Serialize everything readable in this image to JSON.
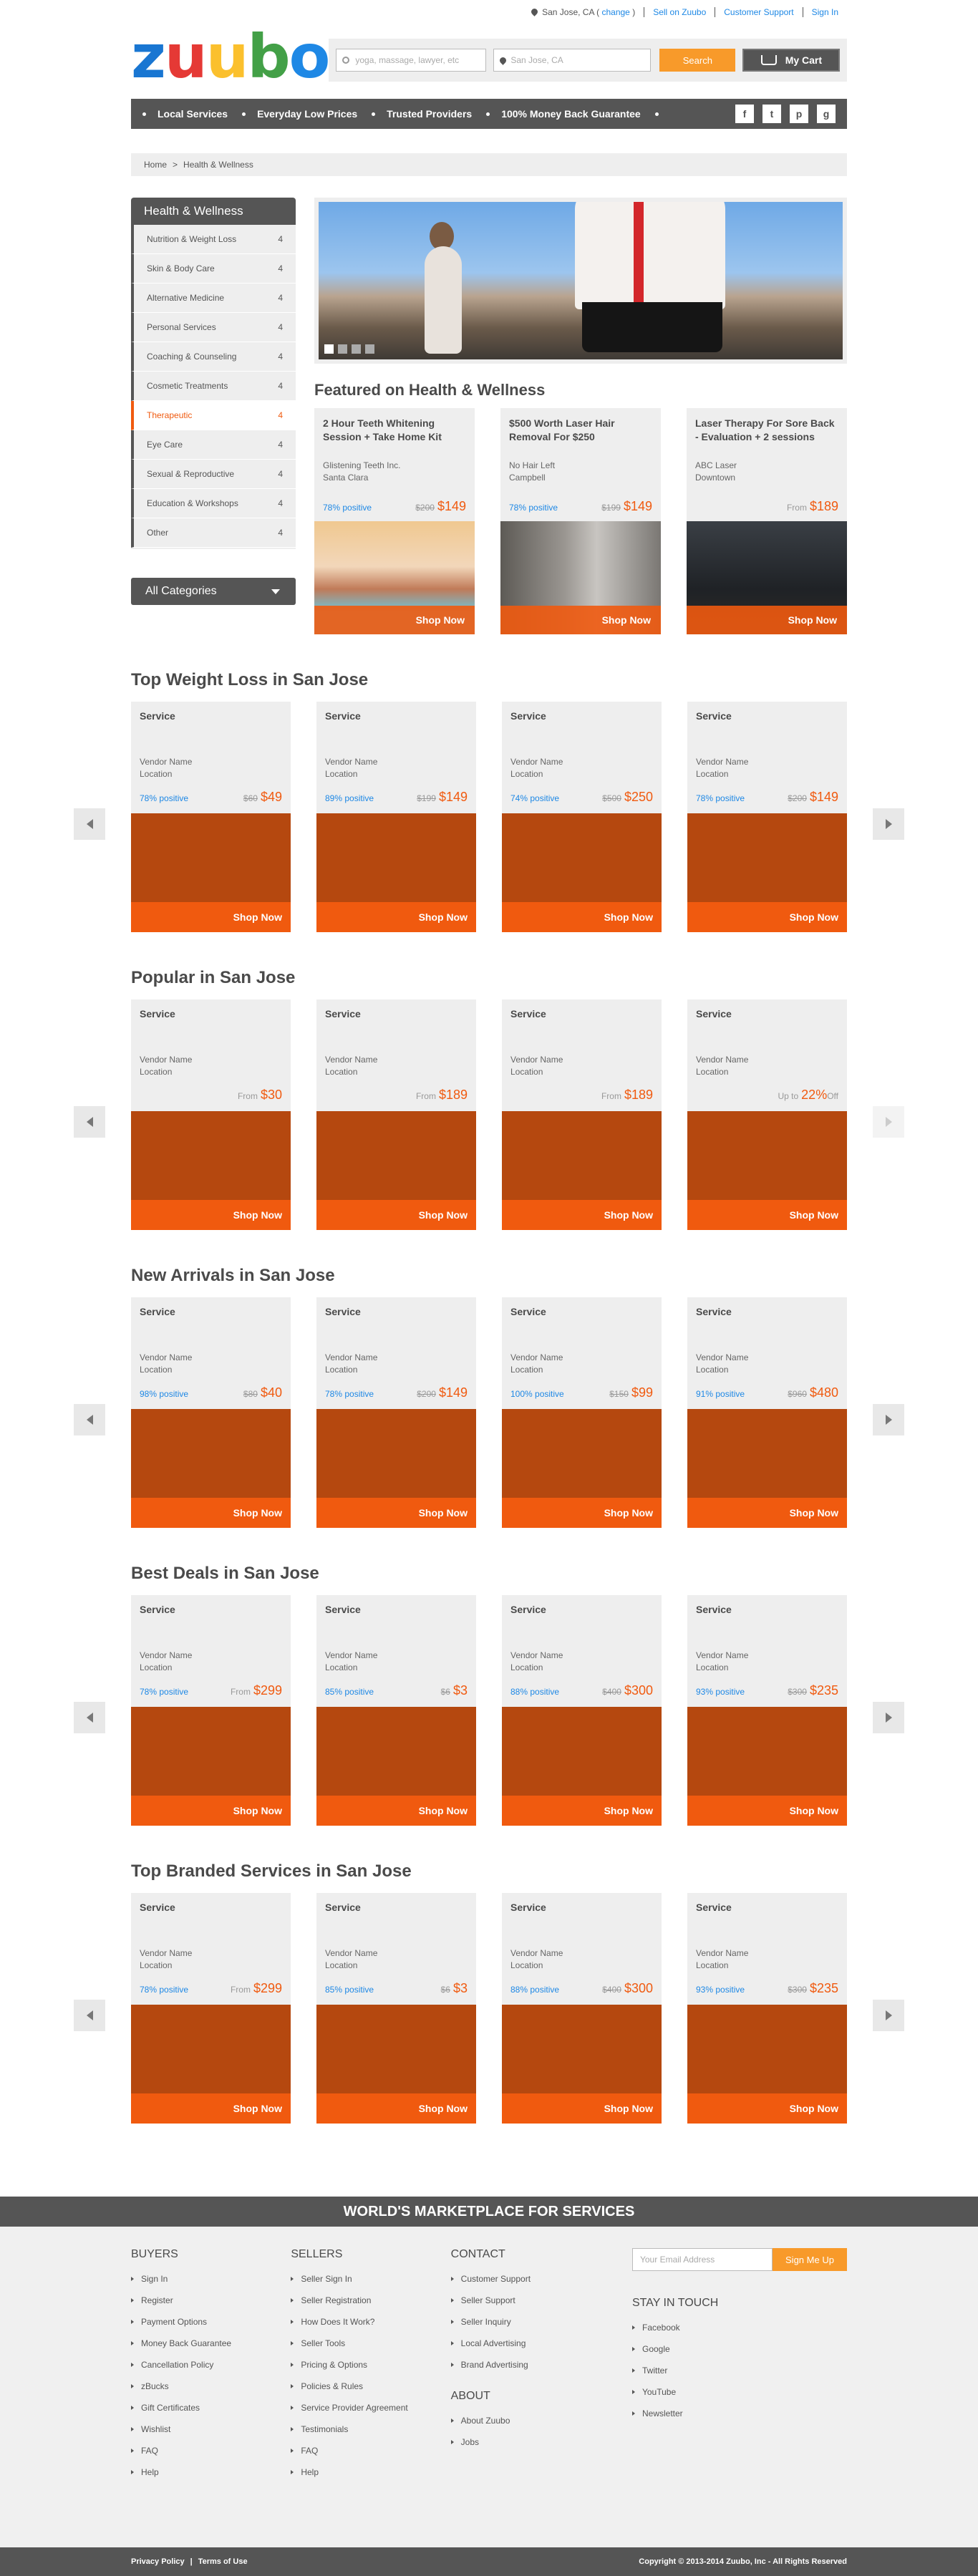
{
  "topbar": {
    "location": "San Jose, CA (",
    "change": "change",
    "location_end": ")",
    "sell": "Sell on Zuubo",
    "support": "Customer Support",
    "signin": "Sign In"
  },
  "header": {
    "logo": [
      "z",
      "u",
      "u",
      "b",
      "o"
    ],
    "search_placeholder": "yoga, massage, lawyer, etc",
    "location_placeholder": "San Jose, CA",
    "search_btn": "Search",
    "cart": "My Cart"
  },
  "nav": {
    "items": [
      "Local Services",
      "Everyday Low Prices",
      "Trusted Providers",
      "100% Money Back Guarantee"
    ],
    "socials": [
      "f",
      "t",
      "p",
      "g"
    ]
  },
  "breadcrumb": {
    "home": "Home",
    "sep": ">",
    "current": "Health & Wellness"
  },
  "sidebar": {
    "title": "Health & Wellness",
    "items": [
      {
        "label": "Nutrition & Weight Loss",
        "count": "4"
      },
      {
        "label": "Skin & Body Care",
        "count": "4"
      },
      {
        "label": "Alternative Medicine",
        "count": "4"
      },
      {
        "label": "Personal Services",
        "count": "4"
      },
      {
        "label": "Coaching & Counseling",
        "count": "4"
      },
      {
        "label": "Cosmetic Treatments",
        "count": "4"
      },
      {
        "label": "Therapeutic",
        "count": "4"
      },
      {
        "label": "Eye Care",
        "count": "4"
      },
      {
        "label": "Sexual & Reproductive",
        "count": "4"
      },
      {
        "label": "Education & Workshops",
        "count": "4"
      },
      {
        "label": "Other",
        "count": "4"
      }
    ],
    "active_index": 6,
    "all_categories": "All Categories"
  },
  "featured": {
    "title": "Featured on Health & Wellness",
    "cards": [
      {
        "title": "2 Hour Teeth Whitening Session + Take Home Kit",
        "vendor": "Glistening Teeth Inc.",
        "location": "Santa Clara",
        "positive": "78% positive",
        "old": "$200",
        "from": "",
        "price": "$149",
        "shop": "Shop Now"
      },
      {
        "title": "$500 Worth Laser Hair Removal For $250",
        "vendor": "No Hair Left",
        "location": "Campbell",
        "positive": "78% positive",
        "old": "$199",
        "from": "",
        "price": "$149",
        "shop": "Shop Now"
      },
      {
        "title": "Laser Therapy For Sore Back - Evaluation + 2 sessions",
        "vendor": "ABC Laser",
        "location": "Downtown",
        "positive": "",
        "old": "",
        "from": "From",
        "price": "$189",
        "shop": "Shop Now"
      }
    ]
  },
  "sections": [
    {
      "title": "Top Weight Loss in San Jose",
      "right_dim": false,
      "cards": [
        {
          "service": "Service",
          "vendor": "Vendor Name",
          "location": "Location",
          "positive": "78% positive",
          "old": "$60",
          "from": "",
          "price": "$49",
          "off": "",
          "shop": "Shop Now"
        },
        {
          "service": "Service",
          "vendor": "Vendor Name",
          "location": "Location",
          "positive": "89% positive",
          "old": "$199",
          "from": "",
          "price": "$149",
          "off": "",
          "shop": "Shop Now"
        },
        {
          "service": "Service",
          "vendor": "Vendor Name",
          "location": "Location",
          "positive": "74% positive",
          "old": "$500",
          "from": "",
          "price": "$250",
          "off": "",
          "shop": "Shop Now"
        },
        {
          "service": "Service",
          "vendor": "Vendor Name",
          "location": "Location",
          "positive": "78% positive",
          "old": "$200",
          "from": "",
          "price": "$149",
          "off": "",
          "shop": "Shop Now"
        }
      ]
    },
    {
      "title": "Popular in San Jose",
      "right_dim": true,
      "cards": [
        {
          "service": "Service",
          "vendor": "Vendor Name",
          "location": "Location",
          "positive": "",
          "old": "",
          "from": "From",
          "price": "$30",
          "off": "",
          "shop": "Shop Now"
        },
        {
          "service": "Service",
          "vendor": "Vendor Name",
          "location": "Location",
          "positive": "",
          "old": "",
          "from": "From",
          "price": "$189",
          "off": "",
          "shop": "Shop Now"
        },
        {
          "service": "Service",
          "vendor": "Vendor Name",
          "location": "Location",
          "positive": "",
          "old": "",
          "from": "From",
          "price": "$189",
          "off": "",
          "shop": "Shop Now"
        },
        {
          "service": "Service",
          "vendor": "Vendor Name",
          "location": "Location",
          "positive": "",
          "old": "",
          "from": "Up to",
          "price": "22%",
          "off": "Off",
          "shop": "Shop Now"
        }
      ]
    },
    {
      "title": "New Arrivals in San Jose",
      "right_dim": false,
      "cards": [
        {
          "service": "Service",
          "vendor": "Vendor Name",
          "location": "Location",
          "positive": "98% positive",
          "old": "$80",
          "from": "",
          "price": "$40",
          "off": "",
          "shop": "Shop Now"
        },
        {
          "service": "Service",
          "vendor": "Vendor Name",
          "location": "Location",
          "positive": "78% positive",
          "old": "$200",
          "from": "",
          "price": "$149",
          "off": "",
          "shop": "Shop Now"
        },
        {
          "service": "Service",
          "vendor": "Vendor Name",
          "location": "Location",
          "positive": "100% positive",
          "old": "$150",
          "from": "",
          "price": "$99",
          "off": "",
          "shop": "Shop Now"
        },
        {
          "service": "Service",
          "vendor": "Vendor Name",
          "location": "Location",
          "positive": "91% positive",
          "old": "$960",
          "from": "",
          "price": "$480",
          "off": "",
          "shop": "Shop Now"
        }
      ]
    },
    {
      "title": "Best Deals in San Jose",
      "right_dim": false,
      "cards": [
        {
          "service": "Service",
          "vendor": "Vendor Name",
          "location": "Location",
          "positive": "78% positive",
          "old": "",
          "from": "From",
          "price": "$299",
          "off": "",
          "shop": "Shop Now"
        },
        {
          "service": "Service",
          "vendor": "Vendor Name",
          "location": "Location",
          "positive": "85% positive",
          "old": "$6",
          "from": "",
          "price": "$3",
          "off": "",
          "shop": "Shop Now"
        },
        {
          "service": "Service",
          "vendor": "Vendor Name",
          "location": "Location",
          "positive": "88% positive",
          "old": "$400",
          "from": "",
          "price": "$300",
          "off": "",
          "shop": "Shop Now"
        },
        {
          "service": "Service",
          "vendor": "Vendor Name",
          "location": "Location",
          "positive": "93% positive",
          "old": "$300",
          "from": "",
          "price": "$235",
          "off": "",
          "shop": "Shop Now"
        }
      ]
    },
    {
      "title": "Top Branded Services in San Jose",
      "right_dim": false,
      "cards": [
        {
          "service": "Service",
          "vendor": "Vendor Name",
          "location": "Location",
          "positive": "78% positive",
          "old": "",
          "from": "From",
          "price": "$299",
          "off": "",
          "shop": "Shop Now"
        },
        {
          "service": "Service",
          "vendor": "Vendor Name",
          "location": "Location",
          "positive": "85% positive",
          "old": "$6",
          "from": "",
          "price": "$3",
          "off": "",
          "shop": "Shop Now"
        },
        {
          "service": "Service",
          "vendor": "Vendor Name",
          "location": "Location",
          "positive": "88% positive",
          "old": "$400",
          "from": "",
          "price": "$300",
          "off": "",
          "shop": "Shop Now"
        },
        {
          "service": "Service",
          "vendor": "Vendor Name",
          "location": "Location",
          "positive": "93% positive",
          "old": "$300",
          "from": "",
          "price": "$235",
          "off": "",
          "shop": "Shop Now"
        }
      ]
    }
  ],
  "footer": {
    "band": "WORLD'S MARKETPLACE FOR SERVICES",
    "buyers": {
      "title": "BUYERS",
      "items": [
        "Sign In",
        "Register",
        "Payment Options",
        "Money Back Guarantee",
        "Cancellation Policy",
        "zBucks",
        "Gift Certificates",
        "Wishlist",
        "FAQ",
        "Help"
      ]
    },
    "sellers": {
      "title": "SELLERS",
      "items": [
        "Seller Sign In",
        "Seller Registration",
        "How Does It Work?",
        "Seller Tools",
        "Pricing & Options",
        "Policies & Rules",
        "Service Provider Agreement",
        "Testimonials",
        "FAQ",
        "Help"
      ]
    },
    "contact": {
      "title": "CONTACT",
      "items": [
        "Customer Support",
        "Seller Support",
        "Seller Inquiry",
        "Local Advertising",
        "Brand Advertising"
      ]
    },
    "about": {
      "title": "ABOUT",
      "items": [
        "About Zuubo",
        "Jobs"
      ]
    },
    "email_placeholder": "Your Email Address",
    "signup": "Sign Me Up",
    "stay": {
      "title": "STAY IN TOUCH",
      "items": [
        "Facebook",
        "Google",
        "Twitter",
        "YouTube",
        "Newsletter"
      ]
    },
    "privacy": "Privacy Policy",
    "bar_sep": "|",
    "terms": "Terms of Use",
    "copyright": "Copyright © 2013-2014 Zuubo, Inc - All Rights Reserved"
  }
}
